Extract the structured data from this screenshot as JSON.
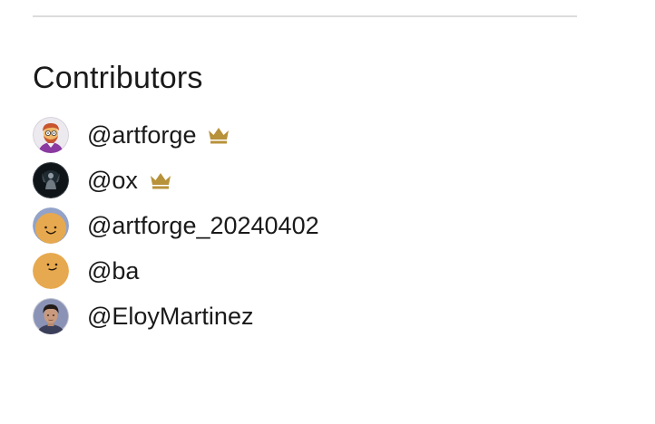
{
  "section": {
    "title": "Contributors"
  },
  "contributors": [
    {
      "handle": "@artforge",
      "avatar": "cartoon-avatar-icon",
      "crown": true
    },
    {
      "handle": "@ox",
      "avatar": "dark-figure-avatar-icon",
      "crown": true
    },
    {
      "handle": "@artforge_20240402",
      "avatar": "smiley-avatar-icon",
      "crown": false
    },
    {
      "handle": "@ba",
      "avatar": "smiley-avatar-icon",
      "crown": false
    },
    {
      "handle": "@EloyMartinez",
      "avatar": "photo-avatar-icon",
      "crown": false
    }
  ],
  "colors": {
    "crown": "#b8923a",
    "smiley": "#e7a94f",
    "divider": "#dcdcdc"
  }
}
